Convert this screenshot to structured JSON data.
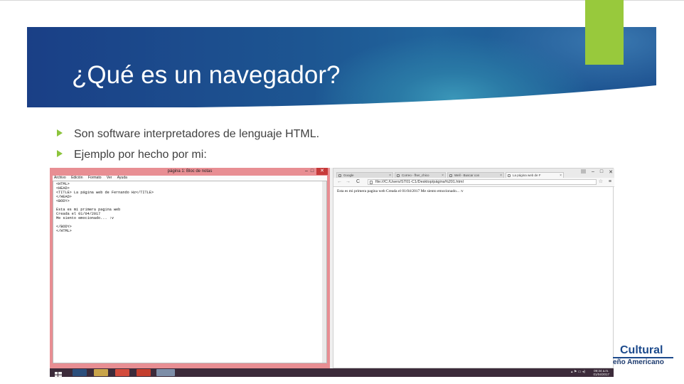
{
  "slide": {
    "title": "¿Qué es un navegador?",
    "bullets": [
      "Son software interpretadores de lenguaje HTML.",
      "Ejemplo por hecho por mi:"
    ]
  },
  "notepad": {
    "window_title": "página 1: Bloc de notas",
    "menu": [
      "Archivo",
      "Edición",
      "Formato",
      "Ver",
      "Ayuda"
    ],
    "content": "<HTML>\n<HEAD>\n<TITLE> La página web de Fernando Hz</TITLE>\n</HEAD>\n<BODY>\n\nEsta es mi primera pagina web\nCreada el 01/04/2017\nMe siento emocionado... :v\n\n</BODY>\n</HTML>"
  },
  "browser": {
    "tabs": [
      "Google",
      "Correo - fher_chico",
      "Well - Buscar con",
      "La página web de F"
    ],
    "address": "file:///C:/Users/ST01-C1/Desktop/página%201.html",
    "page_text": "Esta es mi primera pagina web Creada el 01/04/2017 Me siento emocionado... :v"
  },
  "taskbar": {
    "time": "09:34 a.m.",
    "date": "01/04/2017"
  },
  "logo": {
    "line1": "Cultural",
    "line2": "eño Americano"
  },
  "colors": {
    "accent_green": "#98c93c",
    "banner_blue": "#1d5692",
    "notepad_frame": "#e88e93",
    "logo_blue": "#1c4a8c"
  }
}
